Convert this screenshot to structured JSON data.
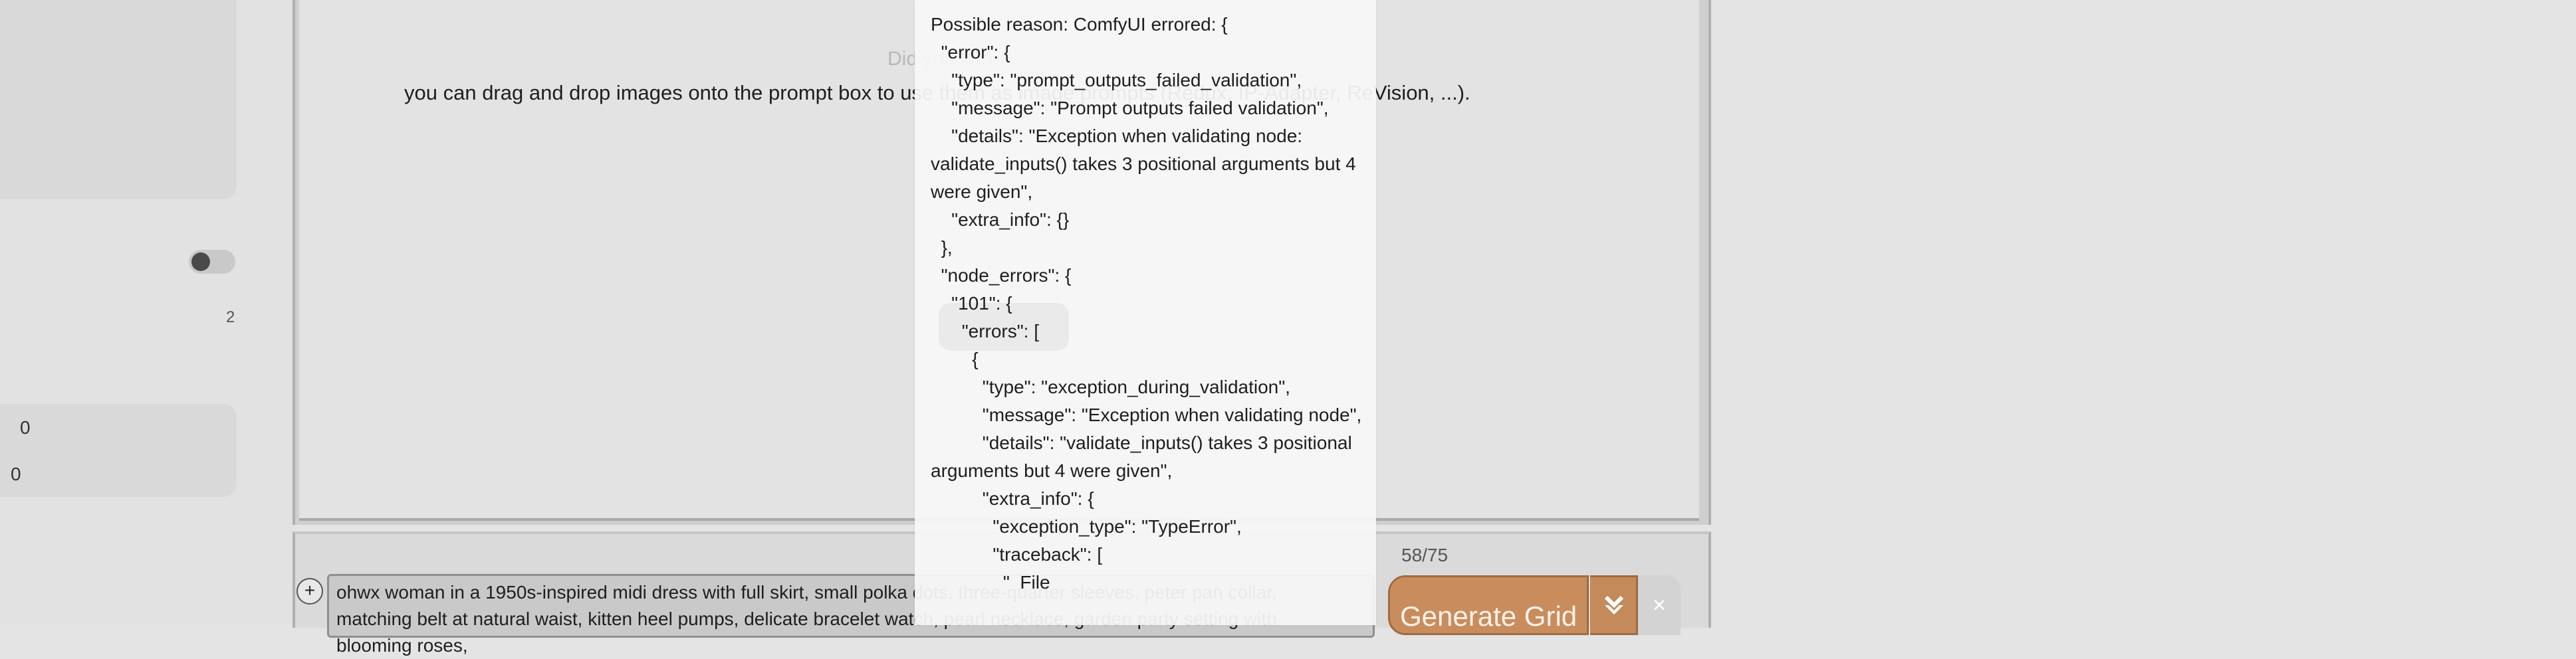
{
  "sidebar": {
    "toggle_state": "off",
    "value_a": "2",
    "value_b": "0",
    "value_c": "0"
  },
  "gallery": {
    "hint_title": "Did you know:",
    "hint_text": "you can drag and drop images onto the prompt box to use them as image prompts (Redux, IP-Adapter, ReVision, ...)."
  },
  "prompt": {
    "add_label": "+",
    "text": "ohwx woman in a 1950s-inspired midi dress with full skirt, small polka dots, three-quarter sleeves, peter pan collar, matching belt at natural waist, kitten heel pumps, delicate bracelet watch, pearl necklace, garden party setting with blooming roses,",
    "token_count": "58/75",
    "generate_label": "Generate Grid",
    "arrow_icon": "chevron-down-icon",
    "cancel_label": "×"
  },
  "error": {
    "text": "Possible reason: ComfyUI errored: {\n  \"error\": {\n    \"type\": \"prompt_outputs_failed_validation\",\n    \"message\": \"Prompt outputs failed validation\",\n    \"details\": \"Exception when validating node: validate_inputs() takes 3 positional arguments but 4 were given\",\n    \"extra_info\": {}\n  },\n  \"node_errors\": {\n    \"101\": {\n      \"errors\": [\n        {\n          \"type\": \"exception_during_validation\",\n          \"message\": \"Exception when validating node\",\n          \"details\": \"validate_inputs() takes 3 positional arguments but 4 were given\",\n          \"extra_info\": {\n            \"exception_type\": \"TypeError\",\n            \"traceback\": [\n              \"  File"
  },
  "colors": {
    "accent": "#c98d5d",
    "accent_border": "#9e6b42",
    "background": "#e4e4e4"
  }
}
